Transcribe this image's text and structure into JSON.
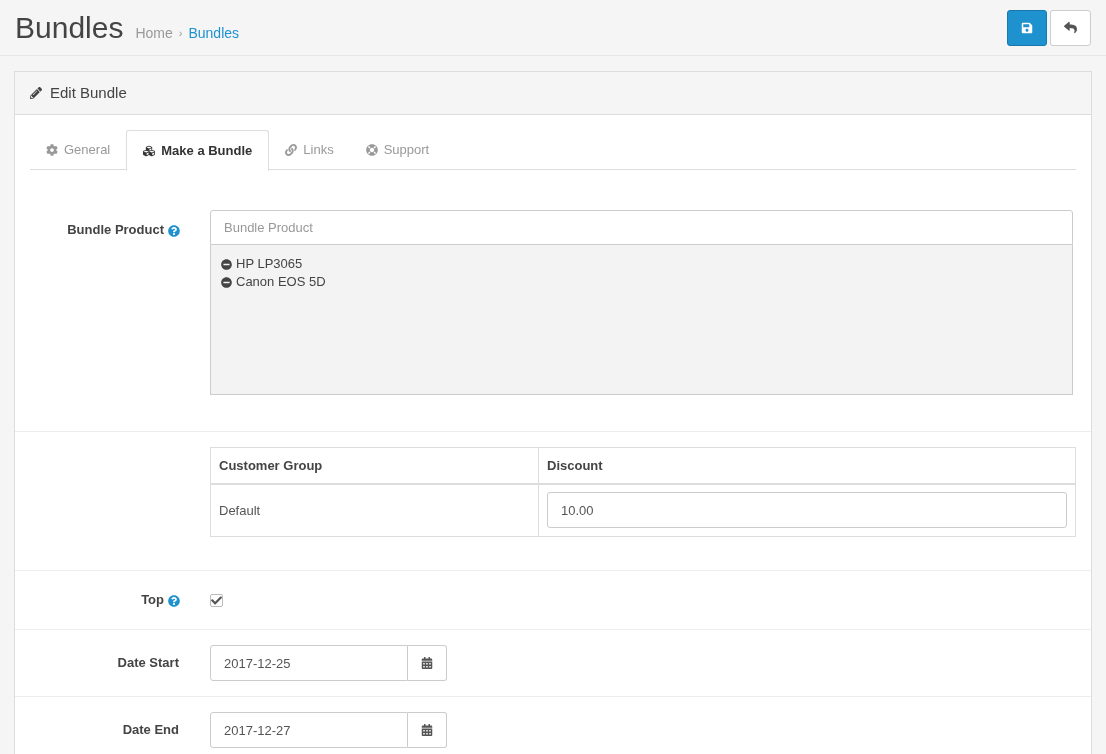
{
  "header": {
    "title": "Bundles",
    "separator": "›",
    "breadcrumb": [
      {
        "label": "Home",
        "selected": false
      },
      {
        "label": "Bundles",
        "selected": true
      }
    ]
  },
  "panel": {
    "title": "Edit Bundle"
  },
  "tabs": [
    {
      "label": "General",
      "selected": false
    },
    {
      "label": "Make a Bundle",
      "selected": true
    },
    {
      "label": "Links",
      "selected": false
    },
    {
      "label": "Support",
      "selected": false
    }
  ],
  "bundle_product": {
    "label": "Bundle Product",
    "placeholder": "Bundle Product",
    "items": [
      "HP LP3065",
      "Canon EOS 5D"
    ]
  },
  "discount_table": {
    "columns": [
      "Customer Group",
      "Discount"
    ],
    "rows": [
      {
        "group": "Default",
        "discount": "10.00"
      }
    ]
  },
  "top": {
    "label": "Top",
    "checked": true
  },
  "dates": [
    {
      "label": "Date Start",
      "value": "2017-12-25"
    },
    {
      "label": "Date End",
      "value": "2017-12-27"
    }
  ]
}
